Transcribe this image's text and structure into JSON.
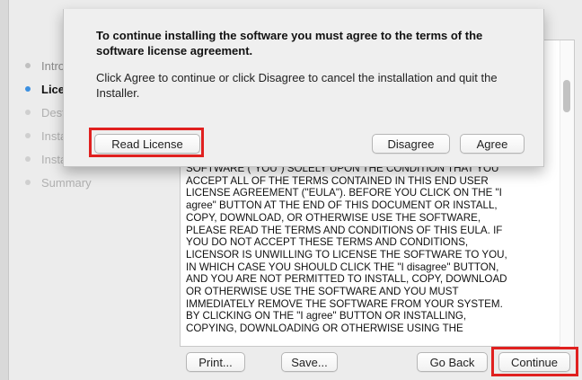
{
  "installer": {
    "steps": [
      {
        "label": "Introduction",
        "state": "done"
      },
      {
        "label": "License",
        "state": "active"
      },
      {
        "label": "Destination Select",
        "state": "pending"
      },
      {
        "label": "Installation Type",
        "state": "pending"
      },
      {
        "label": "Installation",
        "state": "pending"
      },
      {
        "label": "Summary",
        "state": "pending"
      }
    ],
    "panel_peek": "s",
    "license_text": "SOFTWARE (\"YOU\") SOLELY UPON THE CONDITION THAT YOU\nACCEPT ALL OF THE TERMS CONTAINED IN THIS END USER\nLICENSE AGREEMENT (\"EULA\").  BEFORE YOU CLICK ON THE \"I\nagree\" BUTTON AT THE END OF THIS DOCUMENT OR INSTALL,\nCOPY, DOWNLOAD, OR OTHERWISE USE THE SOFTWARE,\nPLEASE READ THE TERMS AND CONDITIONS OF THIS EULA.  IF\nYOU DO NOT ACCEPT THESE TERMS AND CONDITIONS,\nLICENSOR IS UNWILLING TO LICENSE THE SOFTWARE TO YOU,\nIN WHICH CASE YOU SHOULD CLICK THE \"I disagree\" BUTTON,\nAND YOU ARE NOT PERMITTED TO INSTALL, COPY, DOWNLOAD\nOR OTHERWISE USE THE SOFTWARE AND YOU MUST\nIMMEDIATELY REMOVE THE SOFTWARE FROM YOUR SYSTEM.\nBY CLICKING ON THE \"I agree\" BUTTON OR INSTALLING,\nCOPYING, DOWNLOADING OR OTHERWISE USING THE",
    "buttons": {
      "print": "Print...",
      "save": "Save...",
      "go_back": "Go Back",
      "continue": "Continue"
    }
  },
  "sheet": {
    "title": "To continue installing the software you must agree to the terms of the software license agreement.",
    "message": "Click Agree to continue or click Disagree to cancel the installation and quit the Installer.",
    "buttons": {
      "read_license": "Read License",
      "disagree": "Disagree",
      "agree": "Agree"
    }
  },
  "colors": {
    "highlight": "#e0201f",
    "active_step": "#3b8fe0"
  }
}
